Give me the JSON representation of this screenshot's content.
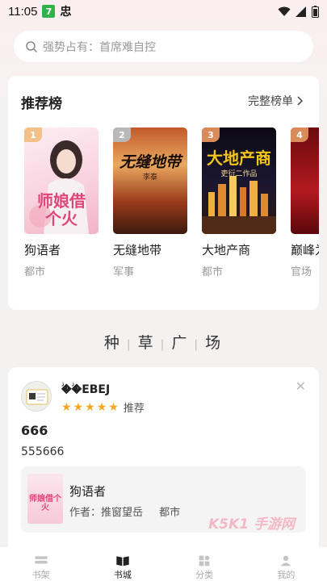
{
  "status_bar": {
    "time": "11:05",
    "badge": "7",
    "app_glyph": "忠"
  },
  "search": {
    "placeholder": "强势占有：首席难自控"
  },
  "ranking": {
    "title": "推荐榜",
    "more_label": "完整榜单",
    "books": [
      {
        "rank": "1",
        "name": "狗语者",
        "category": "都市",
        "cover_text": "师娘借个火",
        "badge_color": "#f3c08a"
      },
      {
        "rank": "2",
        "name": "无缝地带",
        "category": "军事",
        "cover_text": "无缝地带",
        "cover_author": "李泰",
        "badge_color": "#b9b9b9"
      },
      {
        "rank": "3",
        "name": "大地产商",
        "category": "都市",
        "cover_text": "大地产商",
        "cover_author": "吏衍二作品",
        "badge_color": "#d98b5a"
      },
      {
        "rank": "4",
        "name": "巅峰为",
        "category": "官场",
        "cover_text": "",
        "badge_color": "#d98b5a"
      }
    ]
  },
  "section_title": [
    "种",
    "草",
    "广",
    "场"
  ],
  "post": {
    "username": "�ؗ�ؗEBEJ",
    "rating_label": "推荐",
    "stars": 5,
    "title": "666",
    "body": "555666",
    "book": {
      "name": "狗语者",
      "author": "作者：推窗望岳",
      "category": "都市",
      "cover_text": "师娘借个火"
    },
    "watermark": "K5K1 手游网"
  },
  "tabbar": {
    "tabs": [
      {
        "label": "书架",
        "icon": "bookshelf-icon",
        "active": false
      },
      {
        "label": "书城",
        "icon": "open-book-icon",
        "active": true
      },
      {
        "label": "分类",
        "icon": "category-grid-icon",
        "active": false
      },
      {
        "label": "我的",
        "icon": "user-icon",
        "active": false
      }
    ]
  },
  "colors": {
    "star": "#f6a623",
    "accent": "#222222",
    "background": "#f4f1f1"
  }
}
